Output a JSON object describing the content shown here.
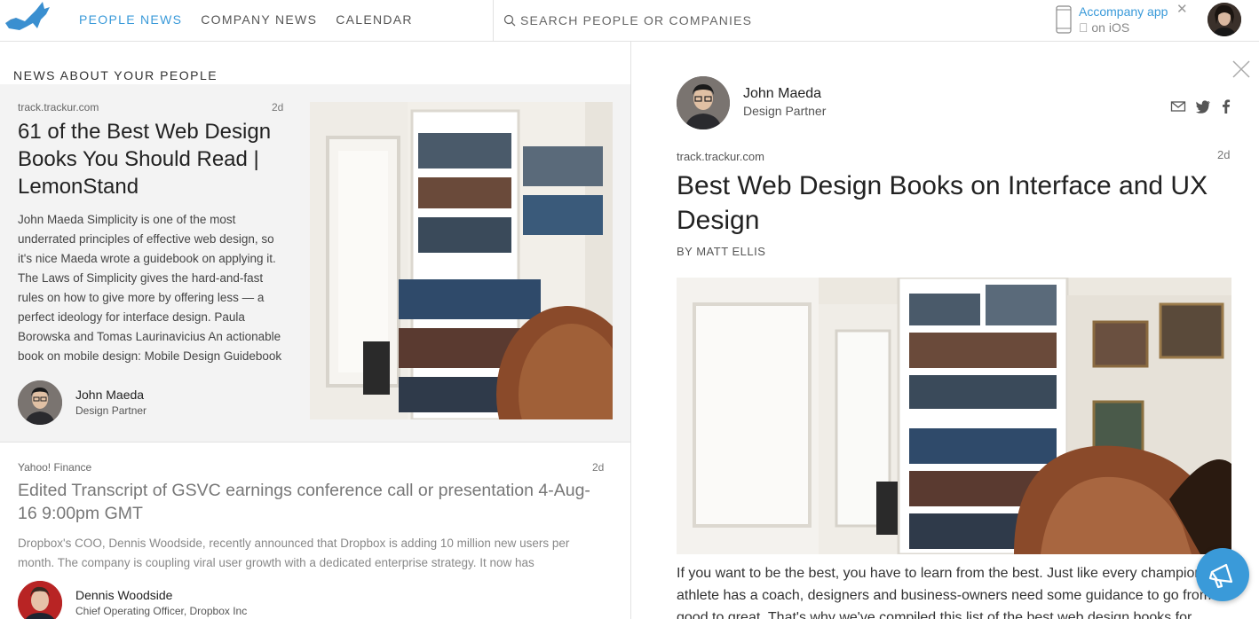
{
  "nav": {
    "people_news": "PEOPLE NEWS",
    "company_news": "COMPANY NEWS",
    "calendar": "CALENDAR"
  },
  "search": {
    "placeholder": "SEARCH PEOPLE OR COMPANIES"
  },
  "app_promo": {
    "link": "Accompany app",
    "platform": "on iOS"
  },
  "feed": {
    "section_title": "NEWS ABOUT YOUR PEOPLE",
    "cards": [
      {
        "source": "track.trackur.com",
        "age": "2d",
        "title": "61 of the Best Web Design Books You Should Read | LemonStand",
        "excerpt": "John Maeda Simplicity is one of the most underrated principles of effective web design, so it's nice Maeda wrote a guidebook on applying it. The Laws of Simplicity gives the hard-and-fast rules on how to give more by offering less — a perfect ideology for interface design. Paula Borowska and Tomas Laurinavicius An actionable book on mobile design: Mobile Design Guidebook",
        "person_name": "John Maeda",
        "person_role": "Design Partner"
      },
      {
        "source": "Yahoo! Finance",
        "age": "2d",
        "title": "Edited Transcript of GSVC earnings conference call or presentation 4-Aug-16 9:00pm GMT",
        "excerpt": "Dropbox's COO, Dennis Woodside, recently announced that Dropbox is adding 10 million new users per month. The company is coupling viral user growth with a dedicated enterprise strategy. It now has",
        "person_name": "Dennis Woodside",
        "person_role": "Chief Operating Officer, Dropbox Inc"
      }
    ]
  },
  "article": {
    "author_name": "John Maeda",
    "author_role": "Design Partner",
    "source": "track.trackur.com",
    "age": "2d",
    "title": "Best Web Design Books on Interface and UX Design",
    "byline": "BY MATT ELLIS",
    "body": "If you want to be the best, you have to learn from the best. Just like every champion athlete has a coach, designers and business-owners need some guidance to go from good to great. That's why we've compiled this list of the best web design books for"
  },
  "colors": {
    "accent": "#3a9ad9",
    "logo": "#3a8fd0"
  }
}
